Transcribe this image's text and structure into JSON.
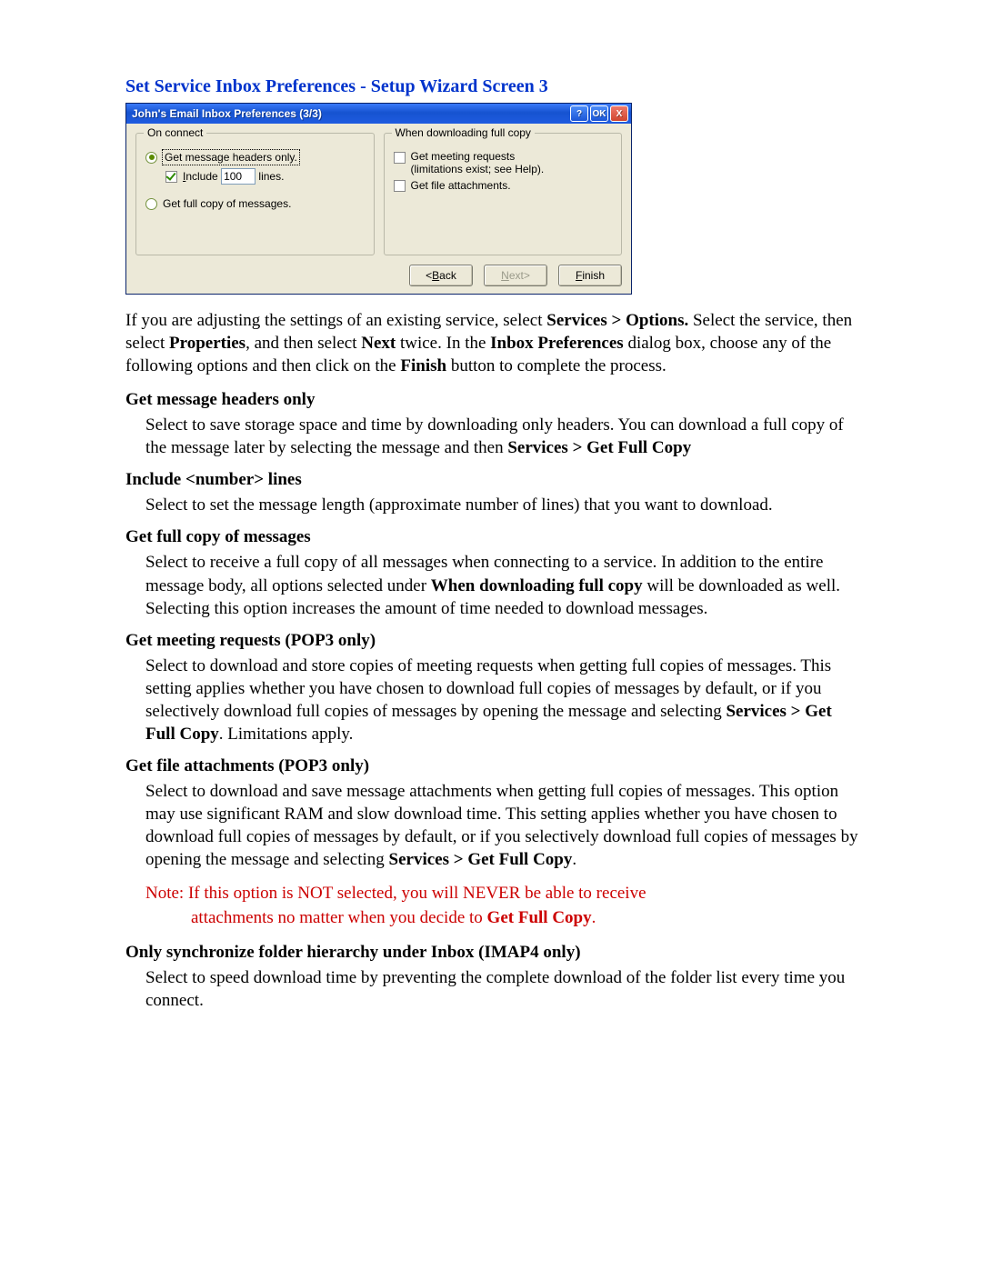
{
  "heading": "Set Service Inbox Preferences  -  Setup Wizard Screen 3",
  "dialog": {
    "title": "John's Email Inbox Preferences (3/3)",
    "help_label": "?",
    "ok_label": "OK",
    "close_label": "X",
    "group_left_legend": "On connect",
    "group_right_legend": "When downloading full copy",
    "opt_headers": "Get message headers only.",
    "opt_include_pre": "Include",
    "opt_include_value": "100",
    "opt_include_post": "lines.",
    "opt_full": "Get full copy of messages.",
    "opt_meeting_line1": "Get meeting requests",
    "opt_meeting_line2": "(limitations exist; see Help).",
    "opt_attach": "Get file attachments.",
    "btn_back_pre": "<",
    "btn_back_lbl": "Back",
    "btn_next_lbl": "Next",
    "btn_next_post": ">",
    "btn_finish_lbl": "Finish"
  },
  "intro": {
    "p1a": "If you are adjusting the settings of an existing service, select ",
    "p1b": "Services > Options.",
    "p1c": "  Select the service, then select ",
    "p1d": "Properties",
    "p1e": ", and then select ",
    "p1f": "Next",
    "p1g": " twice. In the ",
    "p1h": "Inbox Preferences",
    "p1i": " dialog box, choose any of the following options and then click on the ",
    "p1j": "Finish",
    "p1k": " button to complete the process."
  },
  "def1": {
    "h": "Get message headers only",
    "b1": "Select to save storage space and time by downloading only headers.  You can download a full copy of the message later by selecting the message and then ",
    "b2": "Services > Get Full Copy"
  },
  "def2": {
    "h": "Include <number> lines",
    "b": "Select to set the message length (approximate number of lines) that you want to download."
  },
  "def3": {
    "h": "Get full copy of messages",
    "b1": "Select to receive a full copy of all messages when connecting to a service.  In addition to the entire message body, all options selected under ",
    "b2": "When downloading full copy",
    "b3": " will be downloaded as well.  Selecting this option increases the amount of time needed to download messages."
  },
  "def4": {
    "h": "Get meeting requests (POP3 only)",
    "b1": "Select to download and store copies of meeting requests when getting full copies of messages. This setting applies whether you have chosen to download full copies of messages by default, or if you selectively download full copies of messages by opening the message and selecting ",
    "b2": "Services > Get Full Copy",
    "b3": ". Limitations apply."
  },
  "def5": {
    "h": "Get file attachments (POP3 only)",
    "b1": "Select to download and save message attachments when getting full copies of messages. This option may use significant RAM and slow download time. This setting applies whether you have chosen to download full copies of messages by default, or if you selectively download full copies of messages by opening the message and selecting ",
    "b2": "Services > Get Full Copy",
    "b3": "."
  },
  "note": {
    "l1": "Note:  If this option is NOT selected, you will NEVER be able to receive",
    "l2a": "attachments no matter when you decide to ",
    "l2b": "Get Full Copy",
    "l2c": "."
  },
  "def6": {
    "h": "Only synchronize folder hierarchy under Inbox (IMAP4 only)",
    "b": "Select to speed download time by preventing the complete download of the folder list every time you connect."
  }
}
